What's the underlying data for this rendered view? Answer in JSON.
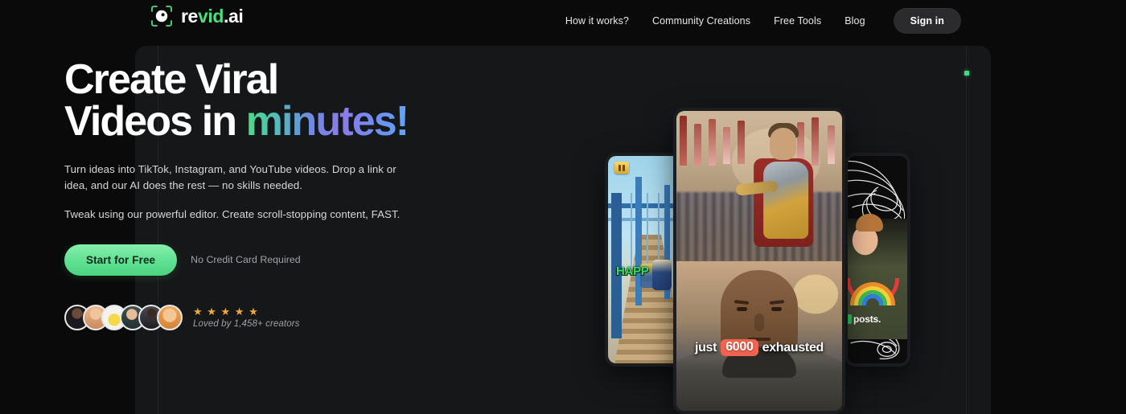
{
  "header": {
    "brand": {
      "part1": "re",
      "part2": "vid",
      "part3": ".ai",
      "icon": "camera-aperture-icon"
    },
    "nav": [
      {
        "label": "How it works?"
      },
      {
        "label": "Community Creations"
      },
      {
        "label": "Free Tools"
      },
      {
        "label": "Blog"
      }
    ],
    "signin_label": "Sign in"
  },
  "hero": {
    "title_line1": "Create Viral",
    "title_line2_plain": "Videos in ",
    "title_line2_gradient": "minutes!",
    "paragraph1": "Turn ideas into TikTok, Instagram, and YouTube videos. Drop a link or idea, and our AI does the rest — no skills needed.",
    "paragraph2": "Tweak using our powerful editor. Create scroll-stopping content, FAST.",
    "cta_label": "Start for Free",
    "cta_note": "No Credit Card Required",
    "stars": "★ ★ ★ ★ ★",
    "loved_text": "Loved by 1,458+ creators"
  },
  "cards": {
    "left": {
      "caption": "HAPP",
      "pause_icon": "pause-icon"
    },
    "center": {
      "caption_before": "just",
      "caption_highlight": "6000",
      "caption_after": "exhausted"
    },
    "right": {
      "caption": "posts."
    }
  },
  "colors": {
    "page_bg": "#0a0a0b",
    "panel_bg": "#161719",
    "accent_green": "#4ade80",
    "cta_green": "#5fe093",
    "star_gold": "#f0a93b",
    "highlight_red": "#f2634f",
    "signin_bg": "#2b2b2e"
  }
}
